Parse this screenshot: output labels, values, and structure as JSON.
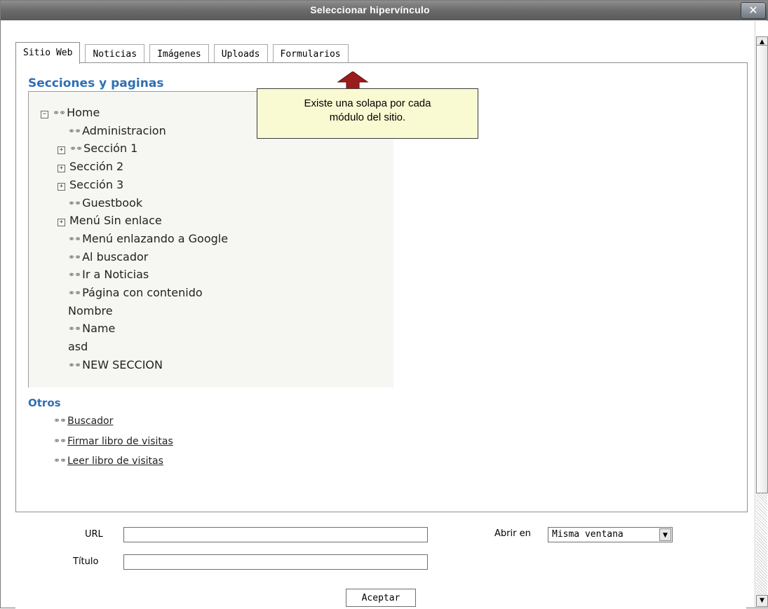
{
  "window": {
    "title": "Seleccionar hipervínculo",
    "close": "✕"
  },
  "tabs": [
    "Sitio Web",
    "Noticias",
    "Imágenes",
    "Uploads",
    "Formularios"
  ],
  "sections": {
    "heading": "Secciones y paginas",
    "tree": [
      {
        "label": "Home",
        "expander": "−",
        "link": true
      },
      {
        "label": "Administracion",
        "expander": "",
        "link": true
      },
      {
        "label": "Sección 1",
        "expander": "+",
        "link": true
      },
      {
        "label": "Sección 2",
        "expander": "+",
        "link": false
      },
      {
        "label": "Sección 3",
        "expander": "+",
        "link": false
      },
      {
        "label": "Guestbook",
        "expander": "",
        "link": true
      },
      {
        "label": "Menú Sin enlace",
        "expander": "+",
        "link": false
      },
      {
        "label": "Menú enlazando a Google",
        "expander": "",
        "link": true
      },
      {
        "label": "Al buscador",
        "expander": "",
        "link": true
      },
      {
        "label": "Ir a Noticias",
        "expander": "",
        "link": true
      },
      {
        "label": "Página con contenido",
        "expander": "",
        "link": true
      },
      {
        "label": "Nombre",
        "expander": "",
        "link": false
      },
      {
        "label": "Name",
        "expander": "",
        "link": true
      },
      {
        "label": "asd",
        "expander": "",
        "link": false
      },
      {
        "label": "NEW SECCION",
        "expander": "",
        "link": true
      }
    ]
  },
  "otros": {
    "heading": "Otros",
    "links": [
      "Buscador",
      "Firmar libro de visitas",
      "Leer libro de visitas"
    ]
  },
  "form": {
    "url_label": "URL",
    "url_value": "",
    "title_label": "Título",
    "title_value": "",
    "open_in_label": "Abrir en",
    "open_in_value": "Misma ventana",
    "accept": "Aceptar"
  },
  "callout": {
    "line1": "Existe una solapa por cada",
    "line2": "módulo del sitio."
  },
  "colors": {
    "heading": "#2f6fb3",
    "callout_bg": "#fafad2",
    "arrow": "#9b1c1c"
  }
}
